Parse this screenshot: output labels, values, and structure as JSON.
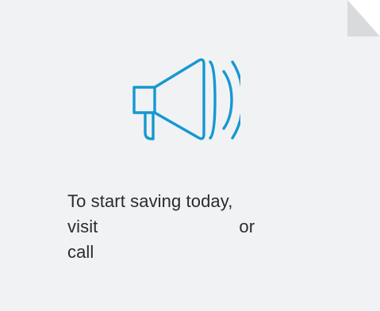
{
  "icon": "megaphone-icon",
  "colors": {
    "card_background": "#f1f2f4",
    "fold": "#d9dadd",
    "icon_stroke": "#1598d2",
    "text": "#2b2b2b"
  },
  "message": {
    "line1": "To start saving today,",
    "line2_start": "visit",
    "line2_end": "or",
    "line3": "call"
  }
}
